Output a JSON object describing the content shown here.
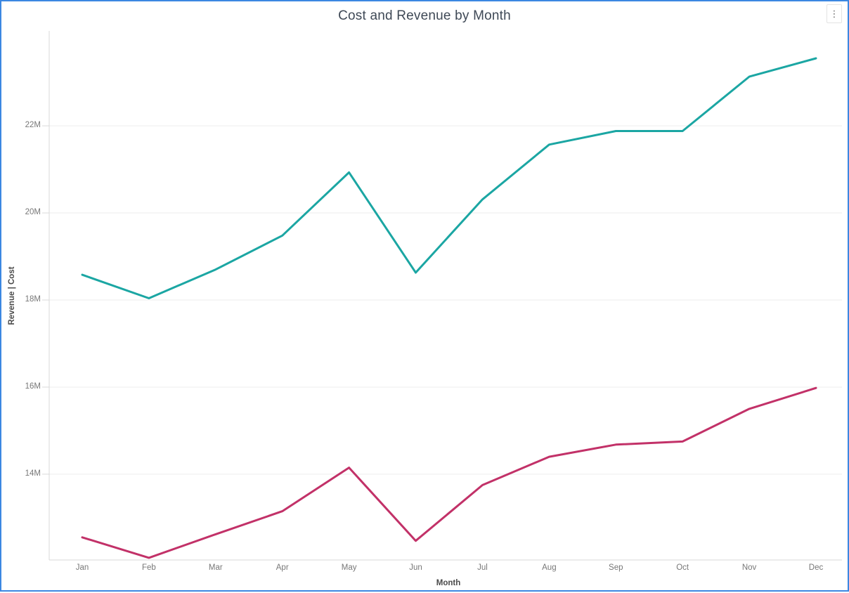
{
  "window": {
    "more_options_icon": "⋮"
  },
  "chart_data": {
    "type": "line",
    "title": "Cost and Revenue by Month",
    "xlabel": "Month",
    "ylabel": "Revenue  |  Cost",
    "legend_position": "none",
    "grid": true,
    "categories": [
      "Jan",
      "Feb",
      "Mar",
      "Apr",
      "May",
      "Jun",
      "Jul",
      "Aug",
      "Sep",
      "Oct",
      "Nov",
      "Dec"
    ],
    "series": [
      {
        "name": "Revenue",
        "color": "#1BA6A3",
        "values": [
          18.58,
          18.04,
          18.7,
          19.48,
          20.93,
          18.63,
          20.31,
          21.57,
          21.88,
          21.88,
          23.13,
          23.55
        ]
      },
      {
        "name": "Cost",
        "color": "#C23168",
        "values": [
          12.55,
          12.08,
          12.62,
          13.15,
          14.15,
          12.47,
          13.75,
          14.4,
          14.68,
          14.75,
          15.5,
          15.98
        ]
      }
    ],
    "unit": "M",
    "ylim": [
      12.03,
      24.18
    ],
    "y_ticks": [
      {
        "value": 14,
        "label": "14M"
      },
      {
        "value": 16,
        "label": "16M"
      },
      {
        "value": 18,
        "label": "18M"
      },
      {
        "value": 20,
        "label": "20M"
      },
      {
        "value": 22,
        "label": "22M"
      }
    ],
    "colors": {
      "grid_line": "#EDEDED",
      "axis_line": "#D9D9D9",
      "frame_border": "#3B87E2"
    }
  }
}
